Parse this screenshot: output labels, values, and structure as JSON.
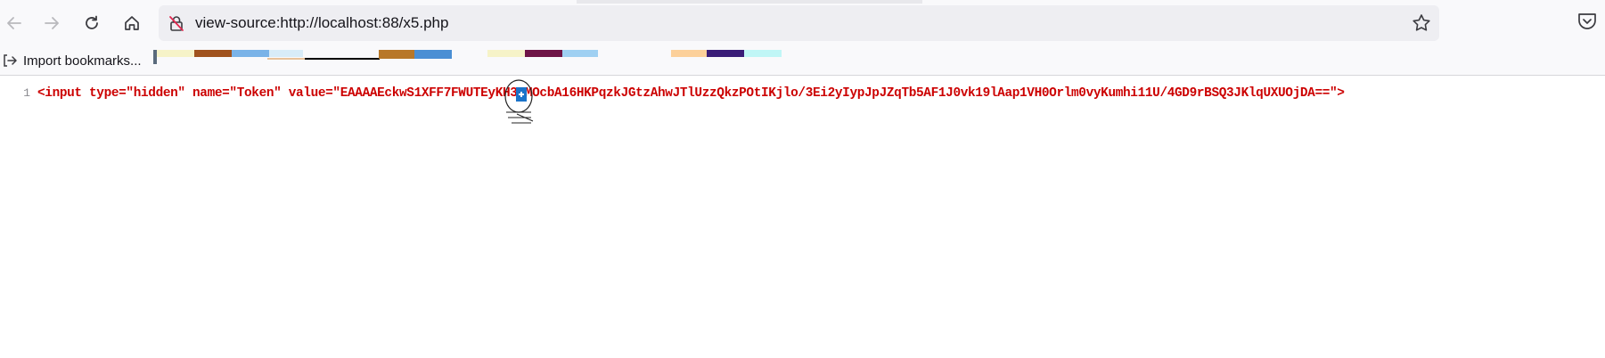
{
  "toolbar": {
    "back_icon": "back-arrow-icon",
    "forward_icon": "forward-arrow-icon",
    "reload_icon": "reload-icon",
    "home_icon": "home-icon"
  },
  "urlbar": {
    "url": "view-source:http://localhost:88/x5.php",
    "lock_icon": "insecure-lock-icon",
    "star_icon": "bookmark-star-icon"
  },
  "pocket_icon": "pocket-icon",
  "bookmarks": {
    "import_label": "Import bookmarks..."
  },
  "source": {
    "line_number": "1",
    "line_text": "<input type=\"hidden\" name=\"Token\" value=\"EAAAAEckwS1XFF7FWUTEyKH3UMOcbA16HKPqzkJGtzAhwJTlUzzQkzPOtIKjlo/3Ei2yIypJpJZqTb5AF1J0vk19lAap1VH0Orlm0vyKumhi11U/4GD9rBSQ3JKlqUXUOjDA==\">"
  }
}
